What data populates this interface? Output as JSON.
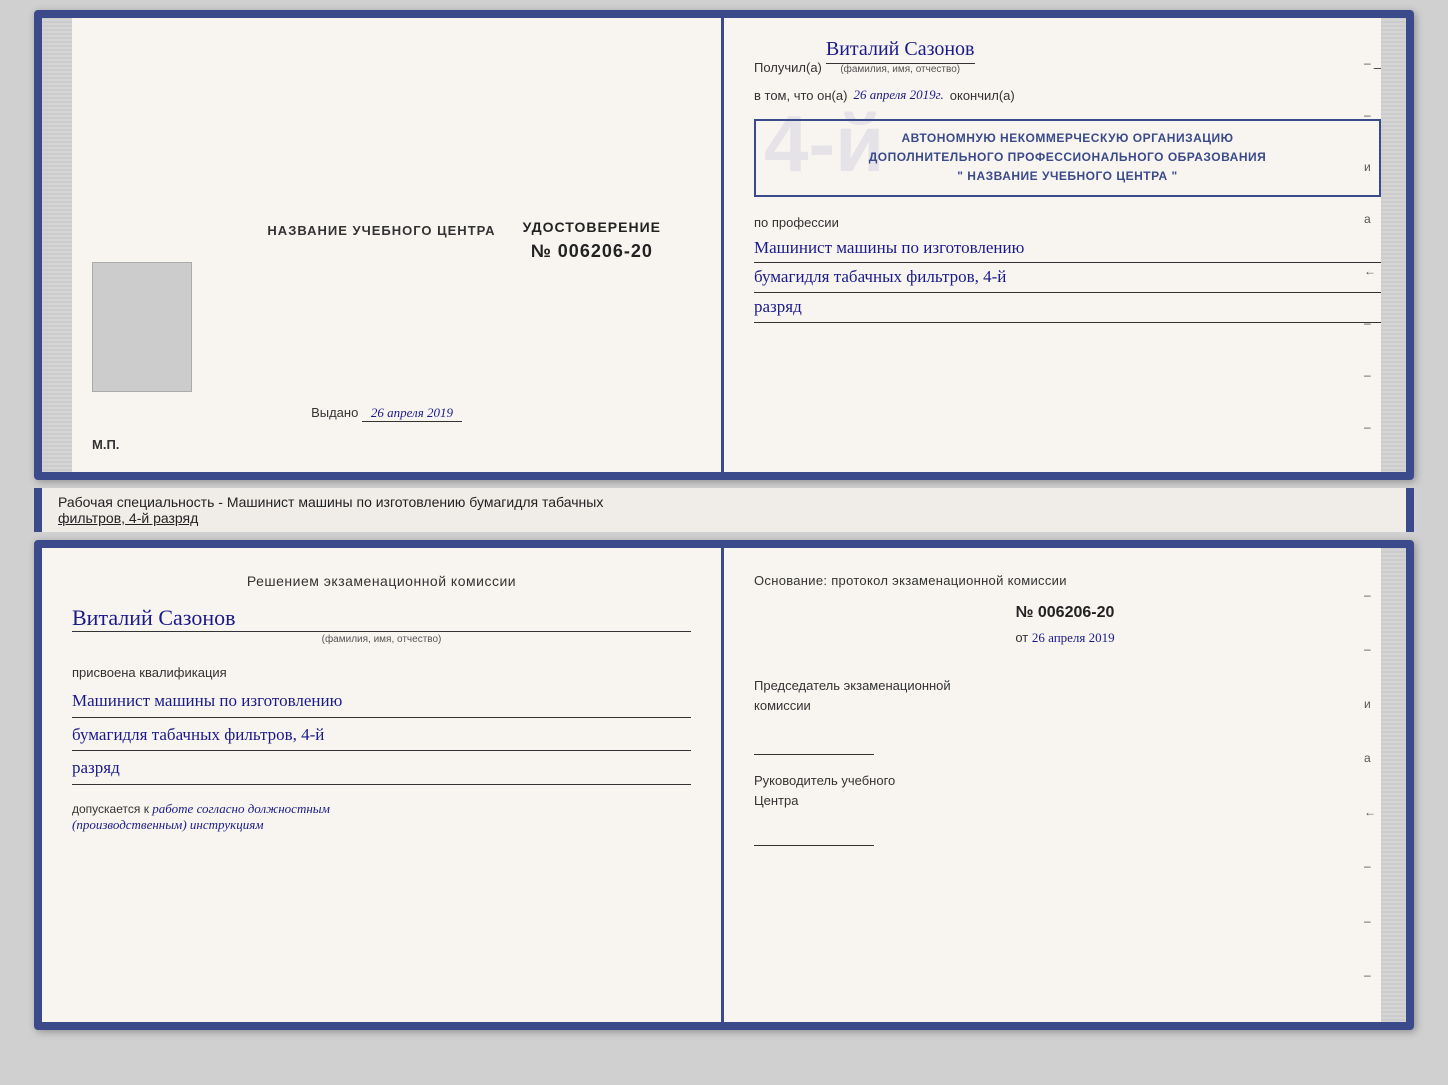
{
  "page": {
    "background_color": "#d0d0d0"
  },
  "top_document": {
    "left_page": {
      "center_name_label": "НАЗВАНИЕ УЧЕБНОГО ЦЕНТРА",
      "cert_title": "УДОСТОВЕРЕНИЕ",
      "cert_number": "№ 006206-20",
      "issued_label": "Выдано",
      "issued_date": "26 апреля 2019",
      "mp_label": "М.П."
    },
    "right_page": {
      "received_prefix": "Получил(а)",
      "recipient_name": "Виталий Сазонов",
      "name_sublabel": "(фамилия, имя, отчество)",
      "in_that_prefix": "в том, что он(а)",
      "in_that_date": "26 апреля 2019г.",
      "finished_word": "окончил(а)",
      "big_number": "4-й",
      "org_line1": "АВТОНОМНУЮ НЕКОММЕРЧЕСКУЮ ОРГАНИЗАЦИЮ",
      "org_line2": "ДОПОЛНИТЕЛЬНОГО ПРОФЕССИОНАЛЬНОГО ОБРАЗОВАНИЯ",
      "org_line3": "\" НАЗВАНИЕ УЧЕБНОГО ЦЕНТРА \"",
      "profession_label": "по профессии",
      "profession_line1": "Машинист машины по изготовлению",
      "profession_line2": "бумагидля табачных фильтров, 4-й",
      "profession_line3": "разряд"
    }
  },
  "description_strip": {
    "text_before_underline": "Рабочая специальность - Машинист машины по изготовлению бумагидля табачных",
    "text_underlined": "фильтров, 4-й разряд"
  },
  "bottom_document": {
    "left_page": {
      "decision_title": "Решением  экзаменационной  комиссии",
      "person_name": "Виталий Сазонов",
      "name_sublabel": "(фамилия, имя, отчество)",
      "qualification_label": "присвоена квалификация",
      "qualification_line1": "Машинист машины по изготовлению",
      "qualification_line2": "бумагидля табачных фильтров, 4-й",
      "qualification_line3": "разряд",
      "admitted_prefix": "допускается к",
      "admitted_text": "работе согласно должностным",
      "admitted_text2": "(производственным) инструкциям"
    },
    "right_page": {
      "basis_label": "Основание: протокол экзаменационной  комиссии",
      "protocol_number": "№  006206-20",
      "date_prefix": "от",
      "date_value": "26 апреля 2019",
      "chairman_label": "Председатель экзаменационной\nкомиссии",
      "director_label": "Руководитель учебного\nЦентра"
    }
  }
}
